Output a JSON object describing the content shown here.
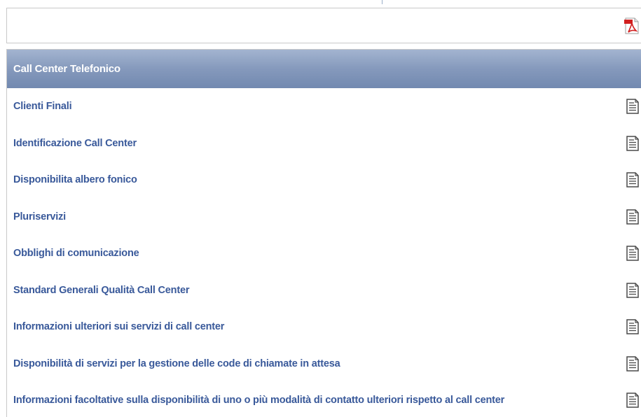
{
  "colors": {
    "header_gradient_top": "#a3b4d0",
    "header_gradient_bottom": "#7289b0",
    "link_text": "#39599a",
    "pdf_red": "#d11f1f"
  },
  "pdf_bar": {
    "icon": "pdf-icon"
  },
  "section": {
    "title": "Call Center Telefonico",
    "row_icon": "document-icon",
    "items": [
      {
        "label": "Clienti Finali"
      },
      {
        "label": "Identificazione Call Center"
      },
      {
        "label": "Disponibilita albero fonico"
      },
      {
        "label": "Pluriservizi"
      },
      {
        "label": "Obblighi di comunicazione"
      },
      {
        "label": "Standard Generali Qualità Call Center"
      },
      {
        "label": "Informazioni ulteriori sui servizi di call center"
      },
      {
        "label": "Disponibilità di servizi per la gestione delle code di chiamate in attesa"
      },
      {
        "label": "Informazioni facoltative sulla disponibilità di uno o più modalità di contatto ulteriori rispetto al call center"
      }
    ]
  }
}
